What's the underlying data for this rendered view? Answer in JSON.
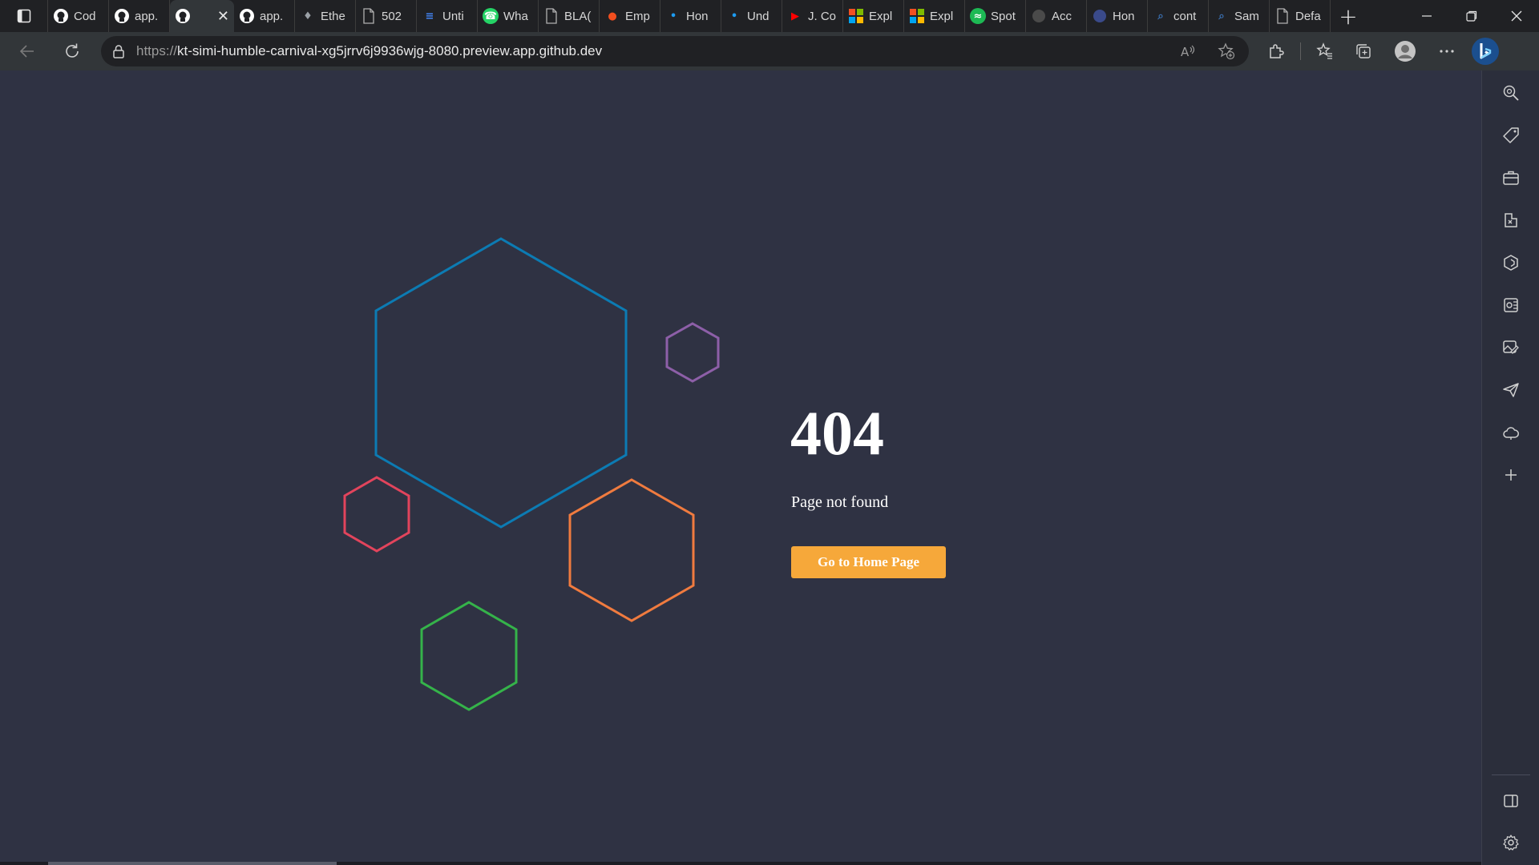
{
  "tabs": [
    {
      "title": "Cod",
      "icon": "github-icon",
      "color": "#ffffff"
    },
    {
      "title": "app.",
      "icon": "github-icon",
      "color": "#ffffff"
    },
    {
      "title": "",
      "icon": "github-icon",
      "color": "#ffffff",
      "active": true
    },
    {
      "title": "app.",
      "icon": "github-icon",
      "color": "#ffffff"
    },
    {
      "title": "Ethe",
      "icon": "ethereum-icon",
      "color": "#9aa0a6"
    },
    {
      "title": "502",
      "icon": "page-icon",
      "color": "#9aa0a6"
    },
    {
      "title": "Unti",
      "icon": "docs-icon",
      "color": "#4285f4"
    },
    {
      "title": "Wha",
      "icon": "whatsapp-icon",
      "color": "#25d366"
    },
    {
      "title": "BLA(",
      "icon": "page-icon",
      "color": "#9aa0a6"
    },
    {
      "title": "Emp",
      "icon": "figma-icon",
      "color": "#f24e1e"
    },
    {
      "title": "Hon",
      "icon": "twitter-icon",
      "color": "#1d9bf0"
    },
    {
      "title": "Und",
      "icon": "twitter-icon",
      "color": "#1d9bf0"
    },
    {
      "title": "J. Co",
      "icon": "youtube-icon",
      "color": "#ff0000"
    },
    {
      "title": "Expl",
      "icon": "microsoft-icon",
      "color": "#f25022"
    },
    {
      "title": "Expl",
      "icon": "microsoft-icon",
      "color": "#f25022"
    },
    {
      "title": "Spot",
      "icon": "spotify-icon",
      "color": "#1db954"
    },
    {
      "title": "Acc",
      "icon": "account-icon",
      "color": "#4a4a4a"
    },
    {
      "title": "Hon",
      "icon": "site-icon",
      "color": "#3a4a8a"
    },
    {
      "title": "cont",
      "icon": "search-icon",
      "color": "#3a6fb0"
    },
    {
      "title": "Sam",
      "icon": "search-icon",
      "color": "#3a6fb0"
    },
    {
      "title": "Defa",
      "icon": "page-icon",
      "color": "#9aa0a6"
    }
  ],
  "address": {
    "scheme": "https://",
    "host": "kt-simi-humble-carnival-xg5jrrv6j9936wjg-8080.preview.app.github.dev"
  },
  "page": {
    "error_code": "404",
    "message": "Page not found",
    "button_label": "Go to Home Page",
    "accent": "#f6a83a",
    "hex_colors": {
      "blue": "#0c7bb3",
      "purple": "#8d5fa8",
      "red": "#e2445c",
      "orange": "#f07b3f",
      "green": "#35b34a"
    }
  },
  "sidebar": {
    "icons": [
      "search-icon",
      "tag-icon",
      "briefcase-icon",
      "games-icon",
      "office-icon",
      "outlook-icon",
      "image-edit-icon",
      "send-icon",
      "cloud-icon",
      "plus-icon"
    ],
    "bottom_icons": [
      "panel-icon",
      "settings-icon"
    ]
  }
}
